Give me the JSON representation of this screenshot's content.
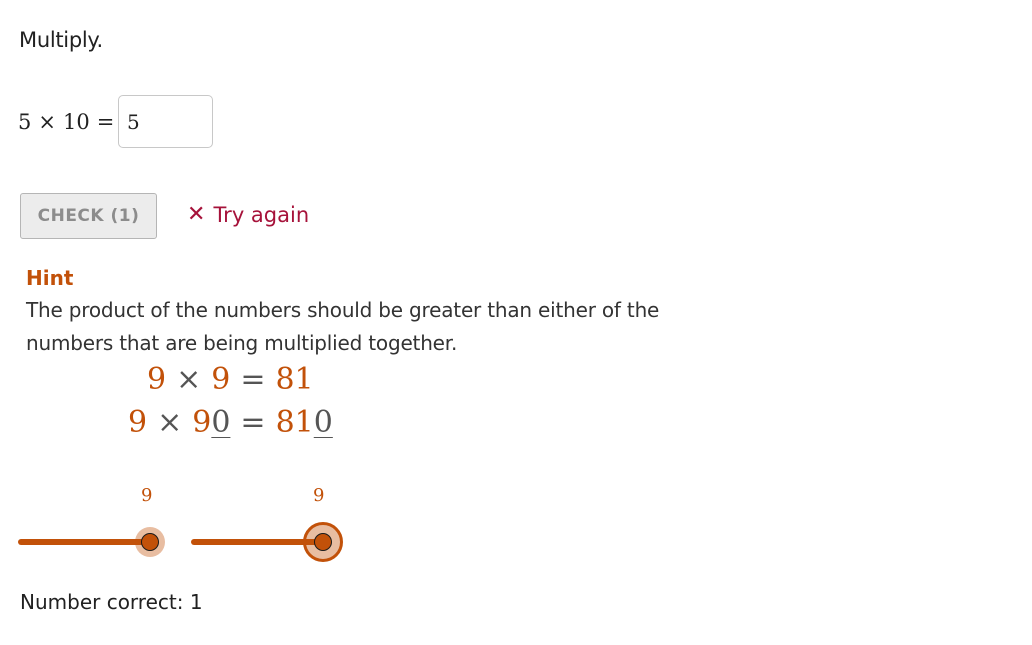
{
  "instruction": "Multiply.",
  "problem": {
    "operand_a": "5",
    "operator": "×",
    "operand_b": "10",
    "equals": "=",
    "answer_value": "5"
  },
  "check_button": {
    "label": "CHECK (1)"
  },
  "feedback": {
    "icon": "x-mark-icon",
    "icon_glyph": "✕",
    "text": "Try again",
    "color": "#a6123a"
  },
  "hint": {
    "title": "Hint",
    "text": "The product of the numbers should be greater than either of the numbers that are being multiplied together.",
    "accent_color": "#c25109",
    "rows": [
      {
        "a": "9",
        "times": "×",
        "b": "9",
        "b_zero": "",
        "equals": "=",
        "product": "81",
        "product_zero": ""
      },
      {
        "a": "9",
        "times": "×",
        "b": "9",
        "b_zero": "0",
        "equals": "=",
        "product": "81",
        "product_zero": "0"
      }
    ]
  },
  "sliders": [
    {
      "name": "first-factor",
      "value": "9",
      "fraction": 1.0,
      "focused": false
    },
    {
      "name": "second-factor",
      "value": "9",
      "fraction": 1.0,
      "focused": true
    }
  ],
  "score": {
    "label": "Number correct: 1"
  }
}
